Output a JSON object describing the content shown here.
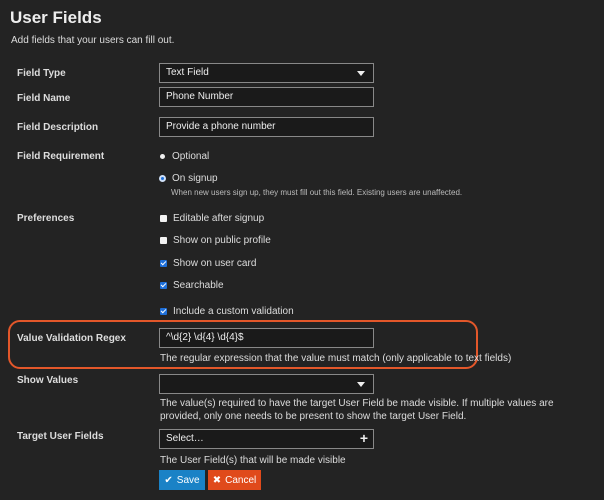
{
  "header": {
    "title": "User Fields",
    "subtitle": "Add fields that your users can fill out."
  },
  "form": {
    "field_type": {
      "label": "Field Type",
      "value": "Text Field"
    },
    "field_name": {
      "label": "Field Name",
      "value": "Phone Number"
    },
    "field_description": {
      "label": "Field Description",
      "value": "Provide a phone number"
    },
    "field_requirement": {
      "label": "Field Requirement",
      "options": [
        {
          "label": "Optional",
          "selected": false
        },
        {
          "label": "On signup",
          "selected": true
        }
      ],
      "help": "When new users sign up, they must fill out this field. Existing users are unaffected."
    },
    "preferences": {
      "label": "Preferences",
      "options": [
        {
          "label": "Editable after signup",
          "checked": false
        },
        {
          "label": "Show on public profile",
          "checked": false
        },
        {
          "label": "Show on user card",
          "checked": true
        },
        {
          "label": "Searchable",
          "checked": true
        },
        {
          "label": "Include a custom validation",
          "checked": true
        }
      ]
    },
    "value_validation_regex": {
      "label": "Value Validation Regex",
      "value": "^\\d{2} \\d{4} \\d{4}$",
      "help": "The regular expression that the value must match (only applicable to text fields)"
    },
    "show_values": {
      "label": "Show Values",
      "value": "",
      "help": "The value(s) required to have the target User Field be made visible. If multiple values are provided, only one needs to be present to show the target User Field."
    },
    "target_user_fields": {
      "label": "Target User Fields",
      "placeholder": "Select…",
      "help": "The User Field(s) that will be made visible"
    }
  },
  "actions": {
    "save_label": "Save",
    "cancel_label": "Cancel"
  },
  "colors": {
    "background": "#232323",
    "accent_blue": "#1a82c6",
    "danger": "#e04a1b",
    "highlight_border": "#e3572a"
  }
}
